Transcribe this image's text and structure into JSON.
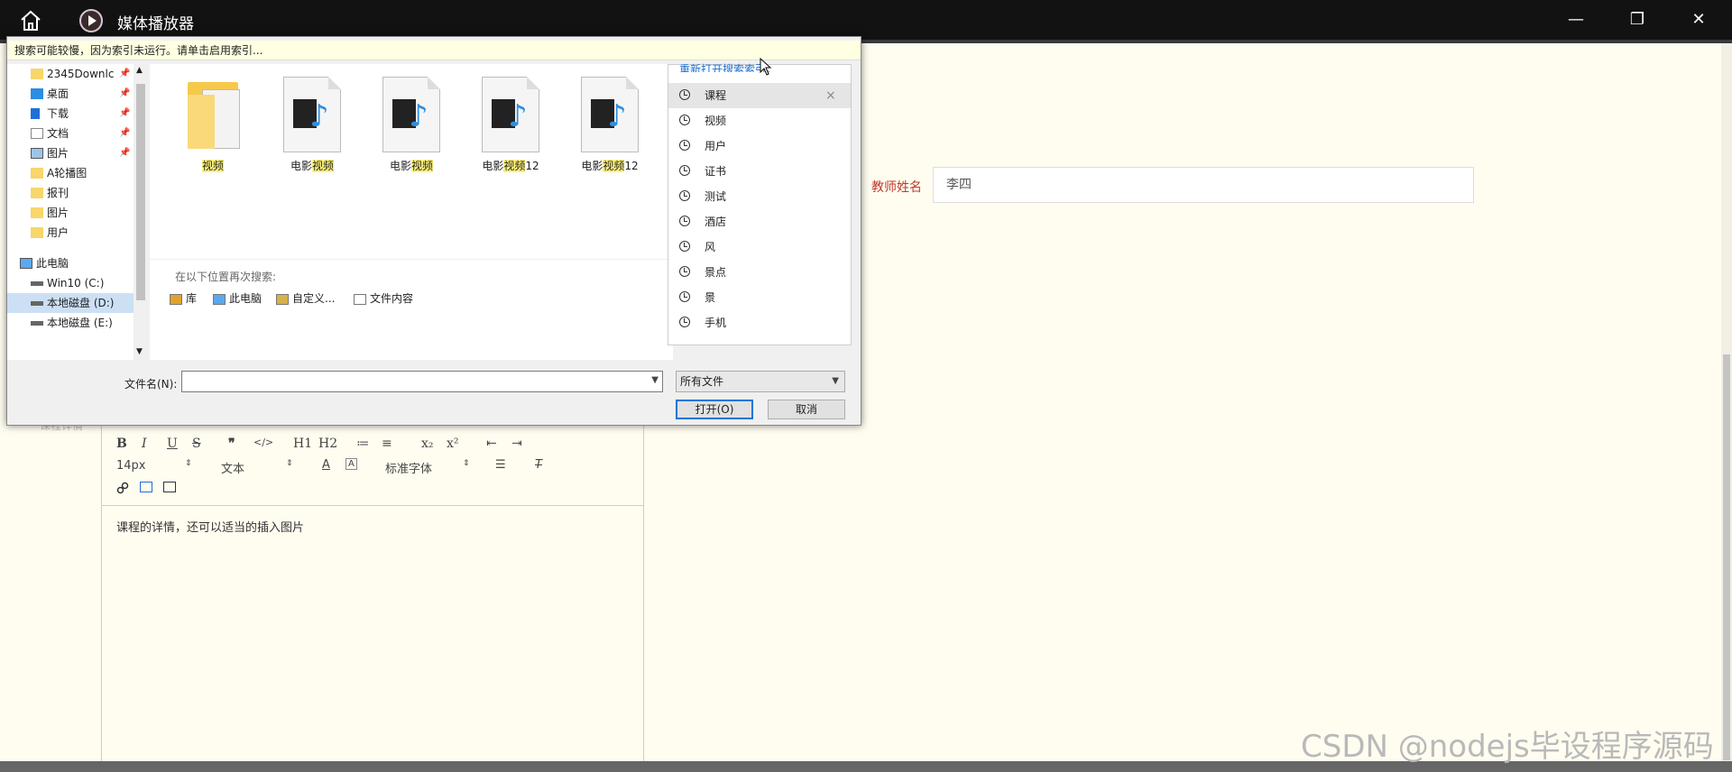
{
  "window": {
    "title": "媒体播放器",
    "home_icon": "home-icon",
    "app_icon": "play-circle-icon",
    "minimize_label": "—",
    "maximize_label": "❐",
    "close_label": "✕"
  },
  "form": {
    "teacher_label": "教师姓名",
    "teacher_value": "李四",
    "detail_label": "课程详情",
    "editor": {
      "row1": [
        "B",
        "I",
        "U",
        "S",
        "❞",
        "</>",
        "H1",
        "H2",
        "≔",
        "≡",
        "x₂",
        "x²",
        "⇤",
        "⇥"
      ],
      "font_size": "14px",
      "block_type": "文本",
      "font_family": "标准字体",
      "content": "课程的详情，还可以适当的插入图片"
    }
  },
  "watermark": "CSDN @nodejs毕设程序源码",
  "dialog": {
    "info_bar": "搜索可能较慢，因为索引未运行。请单击启用索引...",
    "nav_items": [
      {
        "label": "2345Downlc",
        "icon": "folder-icon",
        "pinned": true
      },
      {
        "label": "桌面",
        "icon": "desktop-icon",
        "pinned": true
      },
      {
        "label": "下载",
        "icon": "download-icon",
        "pinned": true
      },
      {
        "label": "文档",
        "icon": "document-icon",
        "pinned": true
      },
      {
        "label": "图片",
        "icon": "picture-icon",
        "pinned": true
      },
      {
        "label": "A轮播图",
        "icon": "folder-icon",
        "pinned": false
      },
      {
        "label": "报刊",
        "icon": "folder-icon",
        "pinned": false
      },
      {
        "label": "图片",
        "icon": "folder-icon",
        "pinned": false
      },
      {
        "label": "用户",
        "icon": "folder-icon",
        "pinned": false
      },
      {
        "label": "此电脑",
        "icon": "computer-icon",
        "pinned": false
      },
      {
        "label": "Win10 (C:)",
        "icon": "drive-icon",
        "pinned": false
      },
      {
        "label": "本地磁盘 (D:)",
        "icon": "drive-icon",
        "pinned": false
      },
      {
        "label": "本地磁盘 (E:)",
        "icon": "drive-icon",
        "pinned": false
      }
    ],
    "files": [
      {
        "prefix": "",
        "match": "视频",
        "suffix": "",
        "type": "folder"
      },
      {
        "prefix": "电影",
        "match": "视频",
        "suffix": "",
        "type": "video"
      },
      {
        "prefix": "电影",
        "match": "视频",
        "suffix": "",
        "type": "video"
      },
      {
        "prefix": "电影",
        "match": "视频",
        "suffix": "12",
        "type": "video"
      },
      {
        "prefix": "电影",
        "match": "视频",
        "suffix": "12",
        "type": "video"
      }
    ],
    "search_again_label": "在以下位置再次搜索:",
    "search_locations": [
      "库",
      "此电脑",
      "自定义...",
      "文件内容"
    ],
    "history_header": "重新打开搜索索引。",
    "history_items": [
      "课程",
      "视频",
      "用户",
      "证书",
      "测试",
      "酒店",
      "风",
      "景点",
      "景",
      "手机"
    ],
    "filename_label": "文件名(N):",
    "filename_value": "",
    "filetype_value": "所有文件",
    "open_label": "打开(O)",
    "cancel_label": "取消"
  }
}
